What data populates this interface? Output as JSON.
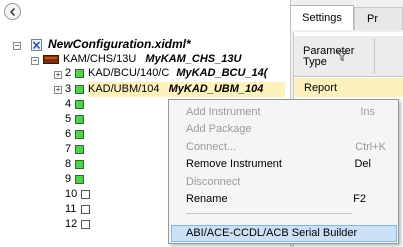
{
  "tree": {
    "root_label": "NewConfiguration.xidml*",
    "crate": {
      "model": "KAM/CHS/13U",
      "name": "MyKAM_CHS_13U"
    },
    "slots": [
      {
        "number": "2",
        "model": "KAD/BCU/140/C",
        "name": "MyKAD_BCU_14(",
        "state": "green"
      },
      {
        "number": "3",
        "model": "KAD/UBM/104",
        "name": "MyKAD_UBM_104",
        "state": "green"
      },
      {
        "number": "4",
        "state": "green"
      },
      {
        "number": "5",
        "state": "green"
      },
      {
        "number": "6",
        "state": "green"
      },
      {
        "number": "7",
        "state": "green"
      },
      {
        "number": "8",
        "state": "green"
      },
      {
        "number": "9",
        "state": "green"
      },
      {
        "number": "10",
        "state": "white"
      },
      {
        "number": "11",
        "state": "white"
      },
      {
        "number": "12",
        "state": "white"
      }
    ]
  },
  "right_panel": {
    "tabs": [
      "Settings",
      "Pr"
    ],
    "param_header": [
      "Parameter",
      "Type"
    ],
    "row_label": "Report"
  },
  "context_menu": {
    "items": [
      {
        "label": "Add Instrument",
        "shortcut": "Ins",
        "enabled": false
      },
      {
        "label": "Add Package",
        "shortcut": "",
        "enabled": false
      },
      {
        "label": "Connect...",
        "shortcut": "Ctrl+K",
        "enabled": false
      },
      {
        "label": "Remove Instrument",
        "shortcut": "Del",
        "enabled": true
      },
      {
        "label": "Disconnect",
        "shortcut": "",
        "enabled": false
      },
      {
        "label": "Rename",
        "shortcut": "F2",
        "enabled": true
      },
      {
        "label": "ABI/ACE-CCDL/ACB Serial Builder",
        "shortcut": "",
        "enabled": true,
        "highlighted": true
      }
    ]
  },
  "icons": [
    "back-arrow-icon",
    "filter-icon",
    "configuration-file-icon",
    "crate-icon",
    "slot-status-icon"
  ],
  "colors": {
    "slot_ok": "#4bd44b",
    "selection": "#fdf1bd",
    "menu_highlight": "#cce1f7"
  }
}
